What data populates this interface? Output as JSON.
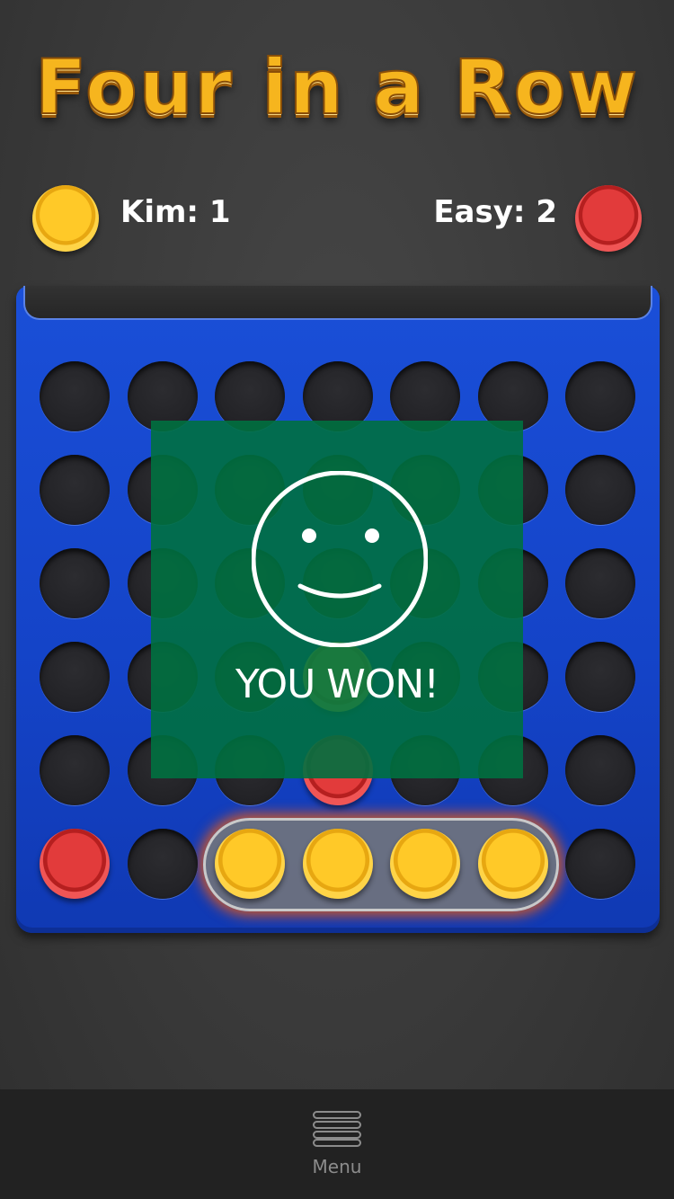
{
  "title": "Four in a Row",
  "players": [
    {
      "label": "Kim: 1",
      "chip_color": "yellow",
      "active": true
    },
    {
      "label": "Easy: 2",
      "chip_color": "red",
      "active": false
    }
  ],
  "board": {
    "columns": 7,
    "rows": 6,
    "grid": [
      [
        "empty",
        "empty",
        "empty",
        "empty",
        "empty",
        "empty",
        "empty"
      ],
      [
        "empty",
        "empty",
        "empty",
        "empty",
        "empty",
        "empty",
        "empty"
      ],
      [
        "empty",
        "empty",
        "empty",
        "empty",
        "empty",
        "empty",
        "empty"
      ],
      [
        "empty",
        "empty",
        "empty",
        "yellow",
        "empty",
        "empty",
        "empty"
      ],
      [
        "empty",
        "empty",
        "empty",
        "red",
        "empty",
        "empty",
        "empty"
      ],
      [
        "red",
        "empty",
        "yellow",
        "yellow",
        "yellow",
        "yellow",
        "empty"
      ]
    ],
    "winning_row": 5,
    "winning_columns": [
      2,
      3,
      4,
      5
    ]
  },
  "result": {
    "message": "YOU WON!",
    "icon": "smiley-icon"
  },
  "bottom_bar": {
    "menu_label": "Menu",
    "menu_icon": "hamburger-icon"
  },
  "colors": {
    "board": "#1443c7",
    "yellow_chip": "#ffc928",
    "red_chip": "#e23b3b",
    "overlay": "#007040",
    "title": "#f6b51e"
  }
}
